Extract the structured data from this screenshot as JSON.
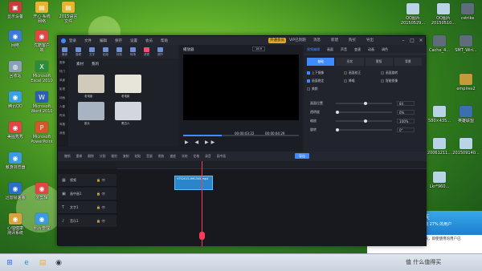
{
  "desktop": {
    "left_icons": [
      {
        "label": "ruler-icon",
        "text": "显示设备",
        "color": "#c93c3c",
        "glyph": "▣"
      },
      {
        "label": "folder",
        "text": "开心·系统\n网络",
        "color": "#e7b332",
        "glyph": "▤"
      },
      {
        "label": "folder",
        "text": "2015语言\n文件",
        "color": "#e7b332",
        "glyph": "▤"
      },
      {
        "label": "network",
        "text": "网络",
        "color": "#3c7ad9",
        "glyph": "◉"
      },
      {
        "label": "store",
        "text": "优酷客户\n端",
        "color": "#e04646",
        "glyph": "◉"
      },
      {
        "label": "sys",
        "text": "回收站",
        "color": "#8aa0b5",
        "glyph": "◍"
      },
      {
        "label": "excel",
        "text": "Microsoft\nExcel 2010",
        "color": "#2e8b3c",
        "glyph": "X"
      },
      {
        "label": "qq",
        "text": "腾讯QQ",
        "color": "#3aa0e6",
        "glyph": "◉"
      },
      {
        "label": "word",
        "text": "Microsoft\nWord 2010",
        "color": "#2c5fb3",
        "glyph": "W"
      },
      {
        "label": "app",
        "text": "美图秀秀",
        "color": "#e04646",
        "glyph": "◉"
      },
      {
        "label": "ppt",
        "text": "Microsoft\nPowerPoint",
        "color": "#d2582b",
        "glyph": "P"
      },
      {
        "label": "app",
        "text": "傲游浏览器",
        "color": "#3a9be0",
        "glyph": "◉"
      },
      {
        "label": "app",
        "text": "迅雷极速版",
        "color": "#2b6fce",
        "glyph": "◉"
      },
      {
        "label": "app",
        "text": "爱剪辑",
        "color": "#e04646",
        "glyph": "◉"
      },
      {
        "label": "app",
        "text": "心理健康\n测评系统",
        "color": "#d9a23a",
        "glyph": "◉"
      },
      {
        "label": "app",
        "text": "照片管理",
        "color": "#3a9be0",
        "glyph": "◉"
      }
    ],
    "right_icons": [
      {
        "text": "QQ图片\n20150529...",
        "color": "#b9d4e6"
      },
      {
        "text": "QQ图片\n20150510...",
        "color": "#b9d4e6"
      },
      {
        "text": "cstrike",
        "color": "#5f6c79"
      },
      {
        "text": "Cache_4...",
        "color": "#5f6c79"
      },
      {
        "text": "SMT_Wiri...",
        "color": "#5f6c79"
      },
      {
        "text": "empires2",
        "color": "#c49a3a"
      },
      {
        "text": "580×435...",
        "color": "#b9d4e6"
      },
      {
        "text": "英雄联盟",
        "color": "#3a6fb0"
      },
      {
        "text": "20061211...",
        "color": "#b9d4e6"
      },
      {
        "text": "201509140...",
        "color": "#b9d4e6"
      },
      {
        "text": "Lkr*960...",
        "color": "#b9d4e6"
      }
    ],
    "notification": {
      "line1": "生活总是以我们最依赖的，也刻在来，即使使用的用户已",
      "line2": "一定会很快就回来以应该会没有..."
    },
    "ad": {
      "title": "天",
      "line1": "微 27% 的用户"
    },
    "watermark": "值 什么值得买"
  },
  "app": {
    "menu": [
      "登录",
      "文件",
      "编辑",
      "保存",
      "设置",
      "会员",
      "帮助"
    ],
    "vip_button": "开通会员",
    "vip_text": "VIP已到期",
    "right_menu": [
      "消息",
      "新建",
      "购买",
      "导出",
      "关闭"
    ],
    "tools": [
      {
        "label": "媒体"
      },
      {
        "label": "音频"
      },
      {
        "label": "文字"
      },
      {
        "label": "贴纸"
      },
      {
        "label": "特效"
      },
      {
        "label": "转场"
      },
      {
        "label": "滤镜"
      },
      {
        "label": "调节"
      }
    ],
    "active_tool": 6,
    "lib_side": [
      "推荐",
      "热门",
      "风景",
      "影视",
      "动画",
      "人像",
      "时尚",
      "风格",
      "其他"
    ],
    "lib_tabs": [
      "素材",
      "我的"
    ],
    "thumbs": [
      {
        "label": "老电影",
        "color": "#cfcab9"
      },
      {
        "label": "老电影",
        "color": "#e7e4da"
      },
      {
        "label": "胶片",
        "color": "#a9b4c3"
      },
      {
        "label": "黑白人",
        "color": "#d4d6de"
      }
    ],
    "player": {
      "title": "播放器",
      "ratio": "16:9",
      "current": "00:00:03:22",
      "total": "00:00:04:29",
      "progress": 0.33
    },
    "props": {
      "tabs": [
        "视频编辑",
        "画面",
        "声音",
        "变速",
        "动画",
        "调色"
      ],
      "active_tab": 0,
      "subtabs": [
        "基础",
        "形状",
        "蒙版",
        "背景"
      ],
      "checkboxes": [
        {
          "label": "上下镜像",
          "on": true
        },
        {
          "label": "画面校正",
          "on": false
        },
        {
          "label": "画面旋转",
          "on": false
        },
        {
          "label": "画面稳定",
          "on": true
        },
        {
          "label": "降噪",
          "on": false
        },
        {
          "label": "智能抠像",
          "on": false
        },
        {
          "label": "美颜",
          "on": false
        }
      ],
      "sliders": [
        {
          "label": "画面位置",
          "value": "84",
          "level": 0.5
        },
        {
          "label": "透明度",
          "value": "0%",
          "level": 0.0
        },
        {
          "label": "缩放",
          "value": "100%",
          "level": 0.5
        },
        {
          "label": "旋转",
          "value": "0°",
          "level": 0.0
        }
      ]
    },
    "timeline_tools": [
      "撤销",
      "重做",
      "删除",
      "分割",
      "裁剪",
      "复制",
      "粘贴",
      "音量",
      "倒放",
      "速度",
      "冻结",
      "定格",
      "录音",
      "画中画"
    ],
    "export_button": "导出",
    "tracks": [
      {
        "name": "视频",
        "icon": "▦"
      },
      {
        "name": "画中画1",
        "icon": "▣"
      },
      {
        "name": "文字1",
        "icon": "T"
      },
      {
        "name": "音乐1",
        "icon": "♪"
      }
    ],
    "clip_label": "VTS2015-IMG345.mp4"
  }
}
